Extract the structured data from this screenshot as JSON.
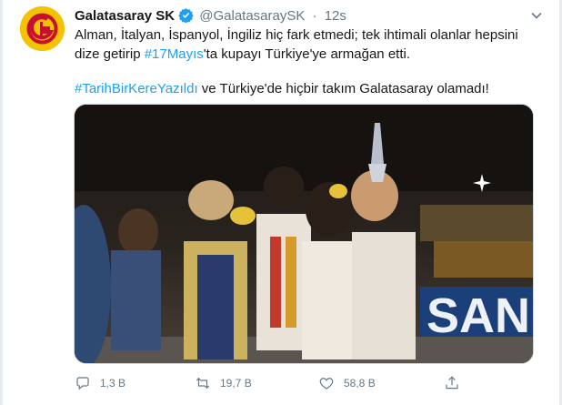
{
  "tweet": {
    "author_name": "Galatasaray SK",
    "handle": "@GalatasaraySK",
    "separator": "·",
    "time": "12s",
    "text_line1": "Alman, İtalyan, İspanyol, İngiliz hiç fark etmedi; tek ihtimali olanlar hepsini dize getirip ",
    "hashtag1": "#17Mayıs",
    "text_line1_end": "'ta kupayı Türkiye'ye armağan etti.",
    "hashtag2": "#TarihBirKereYazıldı",
    "text_line2_end": " ve Türkiye'de hiçbir takım Galatasaray olamadı!",
    "media_banner_text": "SAN"
  },
  "actions": {
    "reply_count": "1,3 B",
    "retweet_count": "19,7 B",
    "like_count": "58,8 B"
  },
  "icons": {
    "avatar": "galatasaray-crest-icon",
    "verified": "verified-badge-icon",
    "caret": "chevron-down-icon",
    "reply": "reply-icon",
    "retweet": "retweet-icon",
    "like": "heart-icon",
    "share": "share-icon"
  },
  "colors": {
    "accent": "#1da1f2",
    "muted": "#657786",
    "crest_yellow": "#f4c300",
    "crest_red": "#c8102e"
  }
}
